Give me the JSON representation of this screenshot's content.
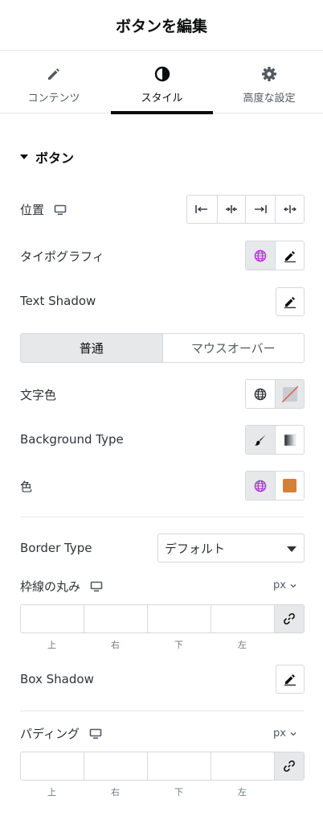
{
  "header": {
    "title": "ボタンを編集"
  },
  "tabs": [
    {
      "label": "コンテンツ",
      "icon": "pencil-icon"
    },
    {
      "label": "スタイル",
      "icon": "contrast-icon",
      "active": true
    },
    {
      "label": "高度な設定",
      "icon": "gear-icon"
    }
  ],
  "section": {
    "title": "ボタン"
  },
  "position": {
    "label": "位置",
    "options": [
      "align-left",
      "align-center",
      "align-right",
      "justify"
    ]
  },
  "typography": {
    "label": "タイポグラフィ"
  },
  "text_shadow": {
    "label": "Text Shadow"
  },
  "state_switch": {
    "normal": "普通",
    "hover": "マウスオーバー"
  },
  "text_color": {
    "label": "文字色"
  },
  "background_type": {
    "label": "Background Type"
  },
  "color": {
    "label": "色",
    "swatch": "#d5803a"
  },
  "border_type": {
    "label": "Border Type",
    "value": "デフォルト"
  },
  "border_radius": {
    "label": "枠線の丸み",
    "unit": "px",
    "sides": [
      "上",
      "右",
      "下",
      "左"
    ]
  },
  "box_shadow": {
    "label": "Box Shadow"
  },
  "padding": {
    "label": "パディング",
    "unit": "px",
    "sides": [
      "上",
      "右",
      "下",
      "左"
    ]
  },
  "colors": {
    "accent": "#ab37d0",
    "active_bg": "#e6e8ea",
    "border": "#d5d8dc"
  }
}
